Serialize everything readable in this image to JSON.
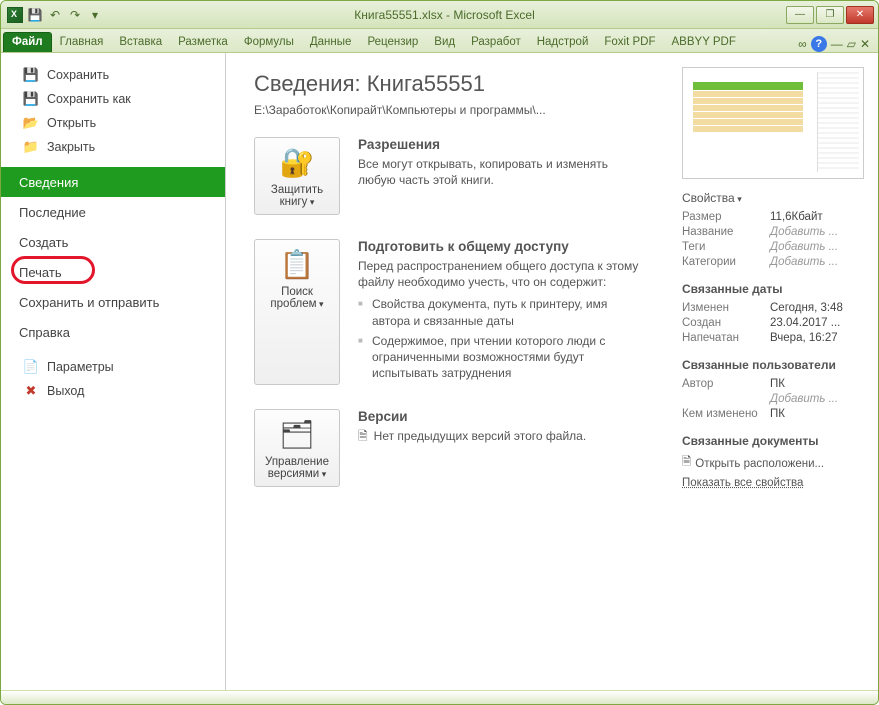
{
  "titlebar": {
    "title": "Книга55551.xlsx - Microsoft Excel"
  },
  "ribbon": {
    "tabs": [
      "Файл",
      "Главная",
      "Вставка",
      "Разметка",
      "Формулы",
      "Данные",
      "Рецензир",
      "Вид",
      "Разработ",
      "Надстрой",
      "Foxit PDF",
      "ABBYY PDF"
    ]
  },
  "sidebar": {
    "top": [
      {
        "icon": "💾",
        "label": "Сохранить"
      },
      {
        "icon": "💾",
        "label": "Сохранить как"
      },
      {
        "icon": "📂",
        "label": "Открыть"
      },
      {
        "icon": "📁",
        "label": "Закрыть"
      }
    ],
    "main_selected": "Сведения",
    "main": [
      "Последние",
      "Создать",
      "Печать",
      "Сохранить и отправить",
      "Справка"
    ],
    "bottom": [
      {
        "icon": "⚙",
        "label": "Параметры"
      },
      {
        "icon": "✖",
        "label": "Выход"
      }
    ]
  },
  "info": {
    "title": "Сведения: Книга55551",
    "path": "E:\\Заработок\\Копирайт\\Компьютеры и программы\\...",
    "permissions": {
      "btn": "Защитить книгу",
      "hd": "Разрешения",
      "txt": "Все могут открывать, копировать и изменять любую часть этой книги."
    },
    "prepare": {
      "btn": "Поиск проблем",
      "hd": "Подготовить к общему доступу",
      "txt": "Перед распространением общего доступа к этому файлу необходимо учесть, что он содержит:",
      "items": [
        "Свойства документа, путь к принтеру, имя автора и связанные даты",
        "Содержимое, при чтении которого люди с ограниченными возможностями будут испытывать затруднения"
      ]
    },
    "versions": {
      "btn": "Управление версиями",
      "hd": "Версии",
      "txt": "Нет предыдущих версий этого файла."
    }
  },
  "right": {
    "props_hd": "Свойства",
    "props": [
      {
        "k": "Размер",
        "v": "11,6Кбайт"
      },
      {
        "k": "Название",
        "v": "Добавить ...",
        "add": true
      },
      {
        "k": "Теги",
        "v": "Добавить ...",
        "add": true
      },
      {
        "k": "Категории",
        "v": "Добавить ...",
        "add": true
      }
    ],
    "dates_hd": "Связанные даты",
    "dates": [
      {
        "k": "Изменен",
        "v": "Сегодня, 3:48"
      },
      {
        "k": "Создан",
        "v": "23.04.2017 ..."
      },
      {
        "k": "Напечатан",
        "v": "Вчера, 16:27"
      }
    ],
    "users_hd": "Связанные пользователи",
    "users": [
      {
        "k": "Автор",
        "v": "ПК"
      },
      {
        "k": "",
        "v": "Добавить ...",
        "add": true
      },
      {
        "k": "Кем изменено",
        "v": "ПК"
      }
    ],
    "docs_hd": "Связанные документы",
    "open_loc": "Открыть расположени...",
    "show_all": "Показать все свойства"
  }
}
